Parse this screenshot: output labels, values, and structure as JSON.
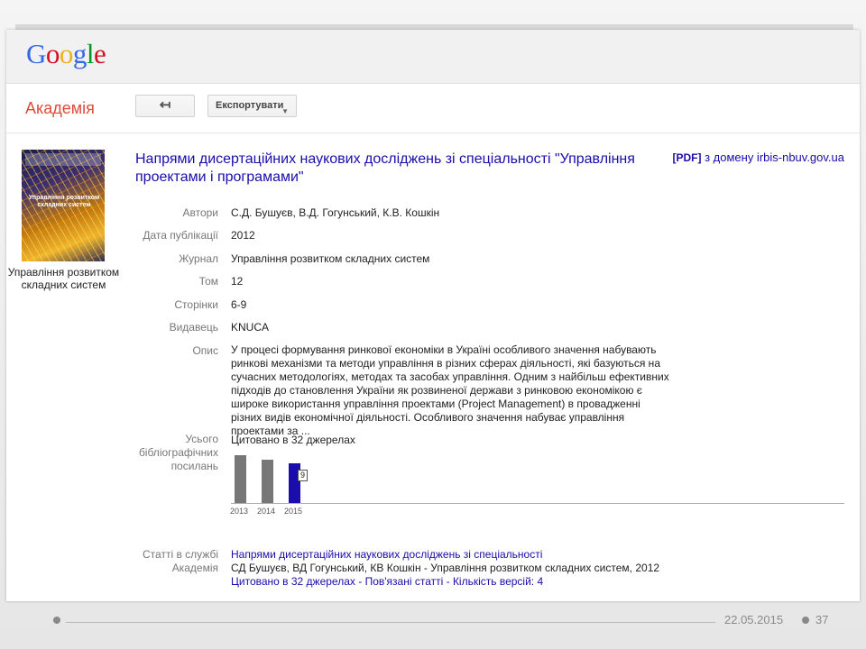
{
  "logo": {
    "g1": "G",
    "o1": "o",
    "o2": "o",
    "g2": "g",
    "l": "l",
    "e": "e"
  },
  "header": {
    "section": "Академія",
    "back_icon": "↤",
    "export_label": "Експортувати",
    "export_caret": "▼"
  },
  "cover": {
    "caption": "Управління розвитком складних систем",
    "inner_title": "Управління розвитком складних систем"
  },
  "article": {
    "title": "Напрями дисертаційних наукових досліджень зі спеціальності \"Управління проектами і програмами\"",
    "pdf_tag": "[PDF]",
    "pdf_source": "з домену irbis-nbuv.gov.ua"
  },
  "fields": {
    "authors_label": "Автори",
    "authors": "С.Д. Бушуєв, В.Д. Гогунський, К.В. Кошкін",
    "date_label": "Дата публікації",
    "date": "2012",
    "journal_label": "Журнал",
    "journal": "Управління розвитком складних систем",
    "volume_label": "Том",
    "volume": "12",
    "pages_label": "Сторінки",
    "pages": "6-9",
    "publisher_label": "Видавець",
    "publisher": "KNUCA",
    "description_label": "Опис",
    "description": "У процесі формування ринкової економіки в Україні особливого значення набувають ринкові механізми та методи управління в різних сферах діяльності, які базуються на сучасних методологіях, методах та засобах управління. Одним з найбільш ефективних підходів до становлення України як розвиненої держави з ринковою економікою є широке використання управління проектами (Project Management) в провадженні різних видів економічної діяльності. Особливого значення набуває управління проектами за ...",
    "citations_label": "Усього бібліографічних посилань",
    "citations_link": "Цитовано в 32 джерелах",
    "scholar_label": "Статті в службі Академія",
    "scholar_title": "Напрями дисертаційних наукових досліджень зі спеціальності",
    "scholar_meta": "СД Бушуєв, ВД Гогунський, КВ Кошкін - Управління розвитком складних систем, 2012",
    "scholar_cited": "Цитовано в 32 джерелах",
    "scholar_sep1": " - ",
    "scholar_related": "Пов'язані статті",
    "scholar_sep2": " - ",
    "scholar_versions": "Кількість версій: 4"
  },
  "chart_data": {
    "type": "bar",
    "categories": [
      "2013",
      "2014",
      "2015"
    ],
    "values": [
      11,
      10,
      9
    ],
    "selected_label": "9",
    "ylim": [
      0,
      12
    ]
  },
  "footer": {
    "date": "22.05.2015",
    "page": "37"
  },
  "colors": {
    "link": "#1a0dab",
    "academy": "#dd4b39",
    "bar": "#777777",
    "bar_selected": "#1a0dab"
  }
}
